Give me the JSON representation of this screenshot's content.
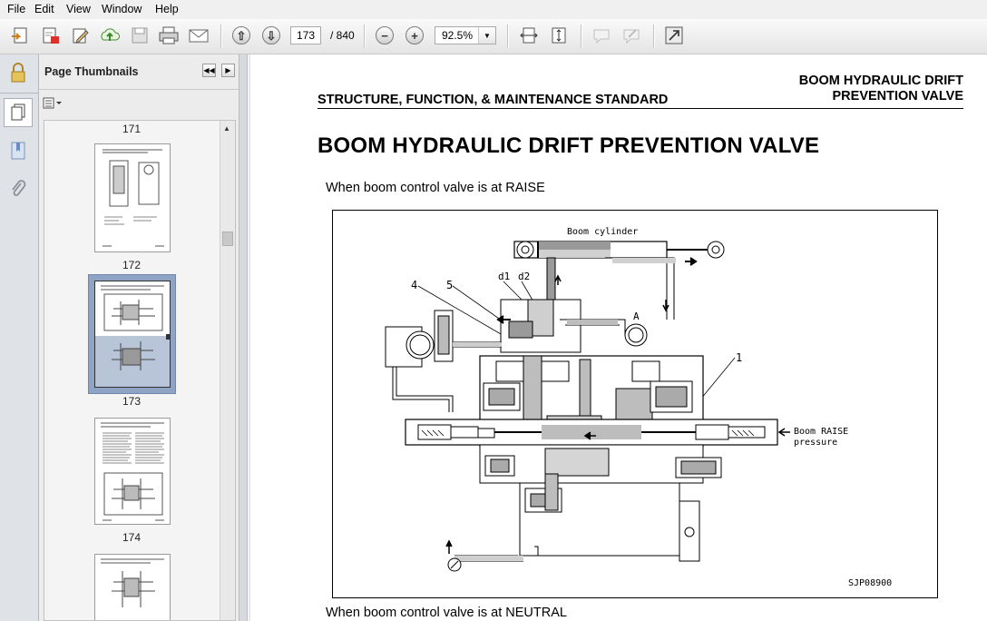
{
  "menu": [
    "File",
    "Edit",
    "View",
    "Window",
    "Help"
  ],
  "toolbar": {
    "current_page": "173",
    "total_pages": "/ 840",
    "zoom": "92.5%",
    "icons": [
      "create-icon",
      "export-icon",
      "edit-icon",
      "upload-icon",
      "save-icon",
      "print-icon",
      "email-icon",
      "previous-page-icon",
      "next-page-icon",
      "zoom-out-icon",
      "zoom-in-icon",
      "fit-width-icon",
      "fit-page-icon",
      "comment-icon",
      "markup-icon",
      "fullscreen-icon"
    ]
  },
  "left_strip": {
    "icons": [
      "lock-icon",
      "page-thumbnails-icon",
      "bookmark-icon",
      "attachment-icon"
    ]
  },
  "panel": {
    "title": "Page Thumbnails",
    "thumbnails": [
      {
        "label": "171"
      },
      {
        "label": "172"
      },
      {
        "label": "173",
        "selected": true
      },
      {
        "label": "174"
      }
    ]
  },
  "document": {
    "header_right_1": "BOOM HYDRAULIC DRIFT",
    "header_right_2": "PREVENTION VALVE",
    "header_left": "STRUCTURE, FUNCTION, & MAINTENANCE STANDARD",
    "title": "BOOM HYDRAULIC DRIFT PREVENTION VALVE",
    "caption_1": "When boom control valve is at RAISE",
    "caption_2": "When boom control valve is at NEUTRAL",
    "figure": {
      "label_cylinder": "Boom cylinder",
      "label_d1": "d1",
      "label_d2": "d2",
      "label_4": "4",
      "label_5": "5",
      "label_A": "A",
      "label_1": "1",
      "label_raise_1": "Boom RAISE",
      "label_raise_2": "pressure",
      "figure_id": "SJP08900"
    }
  },
  "colors": {
    "selection": "#8fa3c4",
    "panel_bg": "#ececec",
    "strip_bg": "#dfe3e8"
  }
}
